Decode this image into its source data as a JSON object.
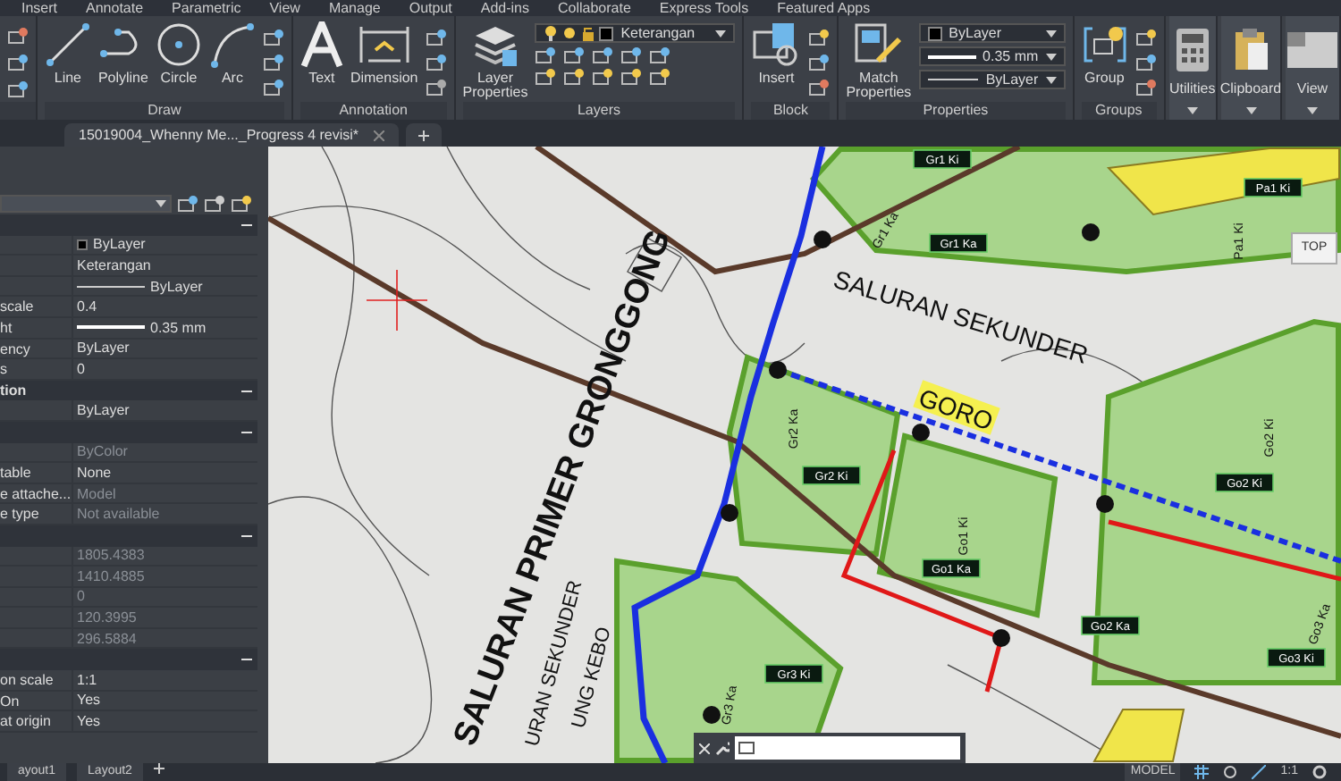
{
  "menu": [
    "Insert",
    "Annotate",
    "Parametric",
    "View",
    "Manage",
    "Output",
    "Add-ins",
    "Collaborate",
    "Express Tools",
    "Featured Apps"
  ],
  "ribbon": [
    {
      "title": "Draw",
      "tools": [
        {
          "label": "Line",
          "kind": "line"
        },
        {
          "label": "Polyline",
          "kind": "polyline"
        },
        {
          "label": "Circle",
          "kind": "circle"
        },
        {
          "label": "Arc",
          "kind": "arc"
        }
      ]
    },
    {
      "title": "Annotation",
      "tools": [
        {
          "label": "Text",
          "kind": "text"
        },
        {
          "label": "Dimension",
          "kind": "dimension"
        }
      ]
    },
    {
      "title": "Layers",
      "tools": [
        {
          "label": "Layer Properties",
          "kind": "layers"
        }
      ],
      "dropdowns": [
        {
          "value": "Keterangan",
          "kind": "layer"
        }
      ]
    },
    {
      "title": "Block",
      "tools": [
        {
          "label": "Insert",
          "kind": "insert"
        }
      ]
    },
    {
      "title": "Properties",
      "tools": [
        {
          "label": "Match Properties",
          "kind": "match"
        }
      ],
      "dropdowns": [
        {
          "value": "ByLayer",
          "kind": "color"
        },
        {
          "value": "0.35 mm",
          "kind": "lineweight"
        },
        {
          "value": "ByLayer",
          "kind": "linetype"
        }
      ]
    },
    {
      "title": "Groups",
      "tools": [
        {
          "label": "Group",
          "kind": "group"
        }
      ]
    }
  ],
  "standalone": [
    {
      "label": "Utilities",
      "kind": "calculator"
    },
    {
      "label": "Clipboard",
      "kind": "clipboard"
    },
    {
      "label": "View",
      "kind": "view"
    }
  ],
  "file_tabs": [
    {
      "label": "15019004_Whenny Me..._Progress 4 revisi*",
      "selected": true
    }
  ],
  "properties": [
    {
      "kind": "section",
      "expanded": true
    },
    {
      "kind": "color",
      "value": "ByLayer",
      "disabled": false
    },
    {
      "kind": "text",
      "value": "Keterangan",
      "disabled": false
    },
    {
      "kind": "linetype",
      "value": "ByLayer",
      "disabled": false
    },
    {
      "kind": "text",
      "label": "scale",
      "value": "0.4",
      "disabled": false
    },
    {
      "kind": "lineweight",
      "label": "ht",
      "value": "0.35 mm",
      "disabled": false
    },
    {
      "kind": "text",
      "label": "ency",
      "value": "ByLayer",
      "disabled": false
    },
    {
      "kind": "text",
      "label": "s",
      "value": "0",
      "disabled": false
    },
    {
      "kind": "section",
      "label": "tion",
      "expanded": true
    },
    {
      "kind": "text",
      "value": "ByLayer",
      "disabled": false
    },
    {
      "kind": "section",
      "expanded": true
    },
    {
      "kind": "text",
      "value": "ByColor",
      "disabled": true
    },
    {
      "kind": "text",
      "label": "table",
      "value": "None",
      "disabled": false
    },
    {
      "kind": "text",
      "label": "e attache...",
      "value": "Model",
      "disabled": true
    },
    {
      "kind": "text",
      "label": "e type",
      "value": "Not available",
      "disabled": true
    },
    {
      "kind": "section",
      "expanded": true
    },
    {
      "kind": "text",
      "value": "1805.4383",
      "disabled": true
    },
    {
      "kind": "text",
      "value": "1410.4885",
      "disabled": true
    },
    {
      "kind": "text",
      "value": "0",
      "disabled": true
    },
    {
      "kind": "text",
      "value": "120.3995",
      "disabled": true
    },
    {
      "kind": "text",
      "value": "296.5884",
      "disabled": true
    },
    {
      "kind": "section",
      "expanded": true
    },
    {
      "kind": "text",
      "label": "on scale",
      "value": "1:1",
      "disabled": false
    },
    {
      "kind": "text",
      "label": "On",
      "value": "Yes",
      "disabled": false
    },
    {
      "kind": "text",
      "label": "at origin",
      "value": "Yes",
      "disabled": false
    }
  ],
  "layout_tabs": [
    "ayout1",
    "Layout2"
  ],
  "map": {
    "canals": [
      "SALURAN PRIMER GRONGGONG",
      "SALURAN SEKUNDER",
      "GORO",
      "URAN SEKUNDER",
      "UNG KEBO"
    ],
    "labels": [
      {
        "text": "Gr1 Ki",
        "kind": "tag"
      },
      {
        "text": "Pa1 Ki",
        "kind": "tag"
      },
      {
        "text": "Gr1 Ka",
        "kind": "tag"
      },
      {
        "text": "Gr2 Ki",
        "kind": "tag"
      },
      {
        "text": "Go1 Ka",
        "kind": "tag"
      },
      {
        "text": "Go2 Ki",
        "kind": "tag"
      },
      {
        "text": "Go2 Ka",
        "kind": "tag"
      },
      {
        "text": "Go3 Ki",
        "kind": "tag"
      },
      {
        "text": "Gr3 Ki",
        "kind": "tag"
      },
      {
        "text": "Gr1 Ka",
        "kind": "plain"
      },
      {
        "text": "Pa1 Ki",
        "kind": "plain"
      },
      {
        "text": "Gr2 Ka",
        "kind": "plain"
      },
      {
        "text": "Go1 Ki",
        "kind": "plain"
      },
      {
        "text": "Go2 Ki",
        "kind": "plain"
      },
      {
        "text": "Go3 Ka",
        "kind": "plain"
      },
      {
        "text": "Gr3 Ka",
        "kind": "plain"
      }
    ],
    "viewcube": "TOP"
  },
  "status": [
    "MODEL",
    "1:1"
  ]
}
